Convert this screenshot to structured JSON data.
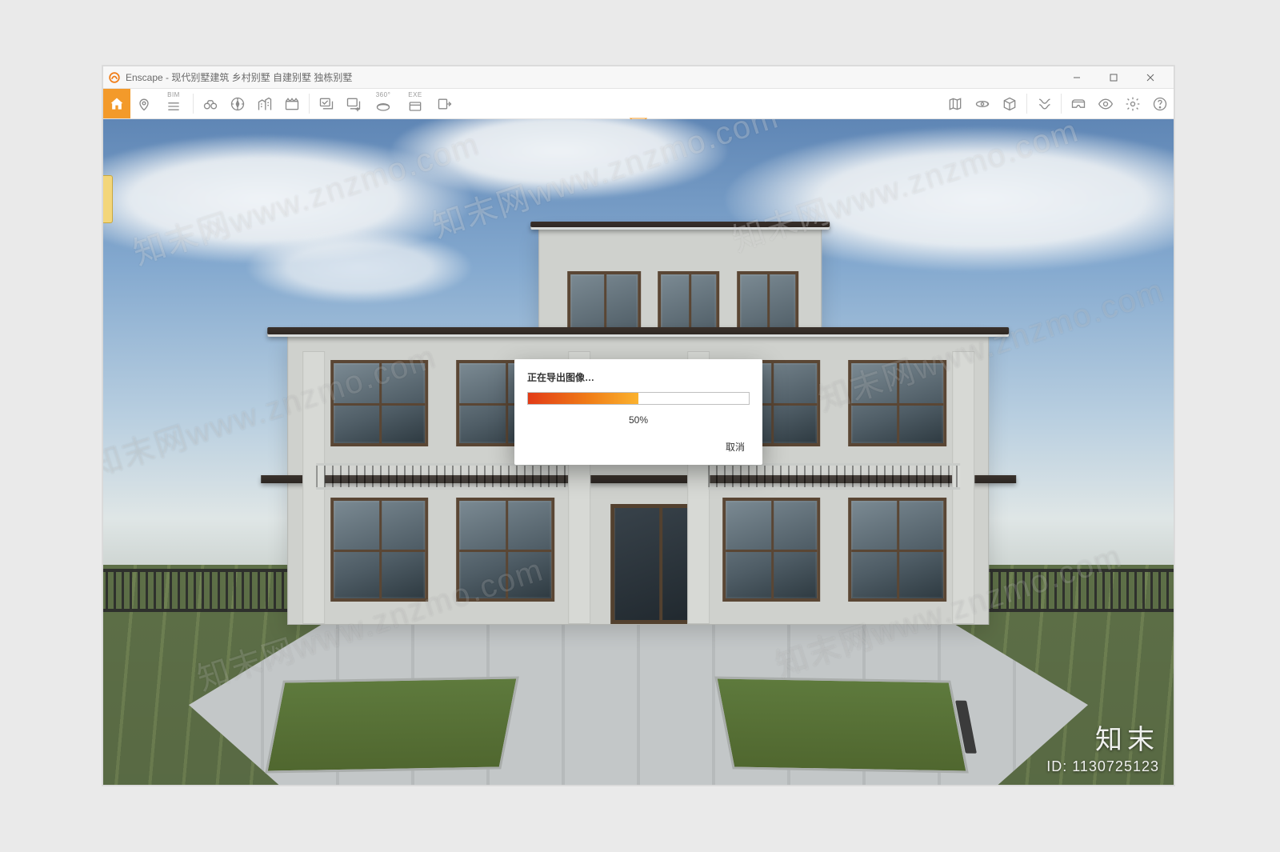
{
  "app": {
    "name": "Enscape",
    "title": "Enscape - 现代别墅建筑 乡村别墅 自建别墅 独栋别墅"
  },
  "window_controls": {
    "minimize": "minimize",
    "maximize": "maximize",
    "close": "close"
  },
  "toolbar": {
    "bim_label": "BIM",
    "exe_label": "EXE",
    "deg_label": "360°",
    "left_items": [
      {
        "name": "home-icon",
        "active": true
      },
      {
        "name": "pin-icon"
      },
      {
        "name": "bim-menu-icon",
        "label": "BIM"
      },
      {
        "name": "binoculars-icon"
      },
      {
        "name": "compass-icon"
      },
      {
        "name": "buildings-icon"
      },
      {
        "name": "clapper-icon"
      },
      {
        "name": "favorites-manage-icon"
      },
      {
        "name": "favorites-add-icon"
      },
      {
        "name": "panorama-360-icon",
        "label": "360°"
      },
      {
        "name": "export-exe-icon",
        "label": "EXE"
      },
      {
        "name": "export-arrow-icon"
      }
    ],
    "right_items": [
      {
        "name": "map-2d-icon"
      },
      {
        "name": "orbit-icon"
      },
      {
        "name": "cube-view-icon"
      },
      {
        "name": "section-icon"
      },
      {
        "name": "vr-headset-icon"
      },
      {
        "name": "visibility-icon"
      },
      {
        "name": "settings-icon"
      },
      {
        "name": "help-icon"
      }
    ]
  },
  "dialog": {
    "title": "正在导出图像…",
    "percent_text": "50%",
    "percent_value": 50,
    "cancel": "取消"
  },
  "watermark": {
    "site_brand": "知末网",
    "site_url": "www.znzmo.com",
    "corner_brand": "知末",
    "id_label": "ID:",
    "id_value": "1130725123"
  }
}
